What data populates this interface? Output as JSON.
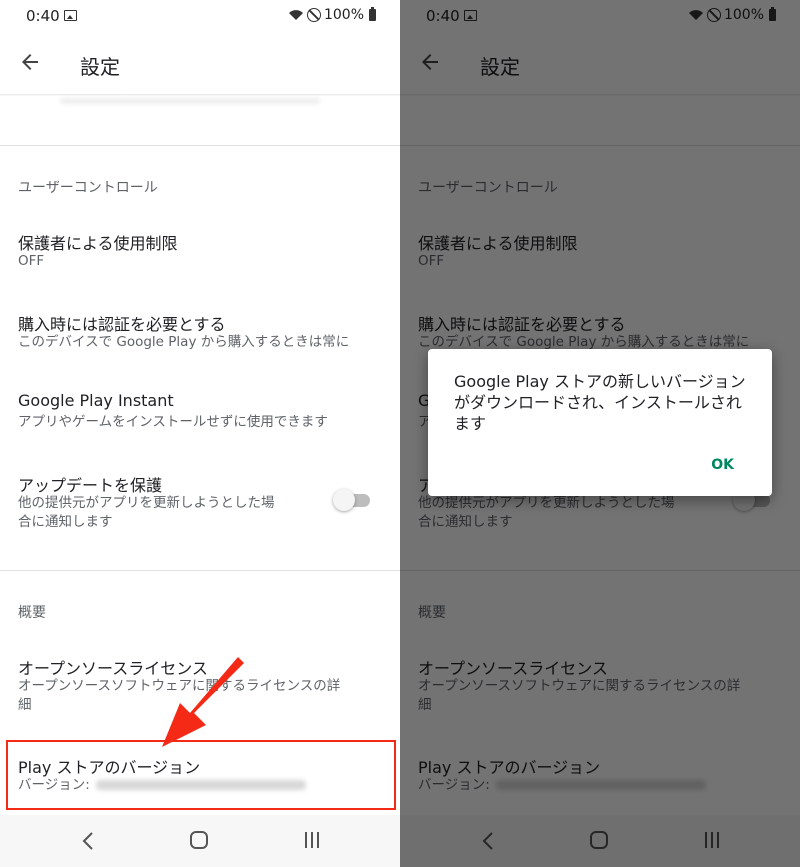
{
  "status_bar": {
    "time": "0:40",
    "battery": "100%"
  },
  "app_bar": {
    "title": "設定"
  },
  "sections": {
    "user_controls": "ユーザーコントロール",
    "about": "概要"
  },
  "items": {
    "parental": {
      "title": "保護者による使用制限",
      "subtitle": "OFF"
    },
    "purchase_auth": {
      "title": "購入時には認証を必要とする",
      "subtitle": "このデバイスで Google Play から購入するときは常に"
    },
    "instant": {
      "title": "Google Play Instant",
      "subtitle": "アプリやゲームをインストールせずに使用できます"
    },
    "update_protect": {
      "title": "アップデートを保護",
      "subtitle_line1": "他の提供元がアプリを更新しようとした場",
      "subtitle_line2": "合に通知します",
      "toggle_on": false
    },
    "licenses": {
      "title": "オープンソースライセンス",
      "subtitle_line1": "オープンソースソフトウェアに関するライセンスの詳",
      "subtitle_line2": "細"
    },
    "version": {
      "title": "Play ストアのバージョン",
      "subtitle": "バージョン:"
    }
  },
  "dialog": {
    "message": "Google Play ストアの新しいバージョンがダウンロードされ、インストールされます",
    "ok": "OK"
  },
  "colors": {
    "highlight": "#f52a16",
    "dialog_button": "#01875f",
    "scrim": "rgba(0,0,0,0.55)"
  },
  "icons": [
    "image-icon",
    "wifi-icon",
    "no-signal-icon",
    "battery-icon",
    "back-arrow-icon",
    "nav-back-icon",
    "nav-home-icon",
    "nav-recents-icon",
    "annotation-arrow-icon"
  ]
}
